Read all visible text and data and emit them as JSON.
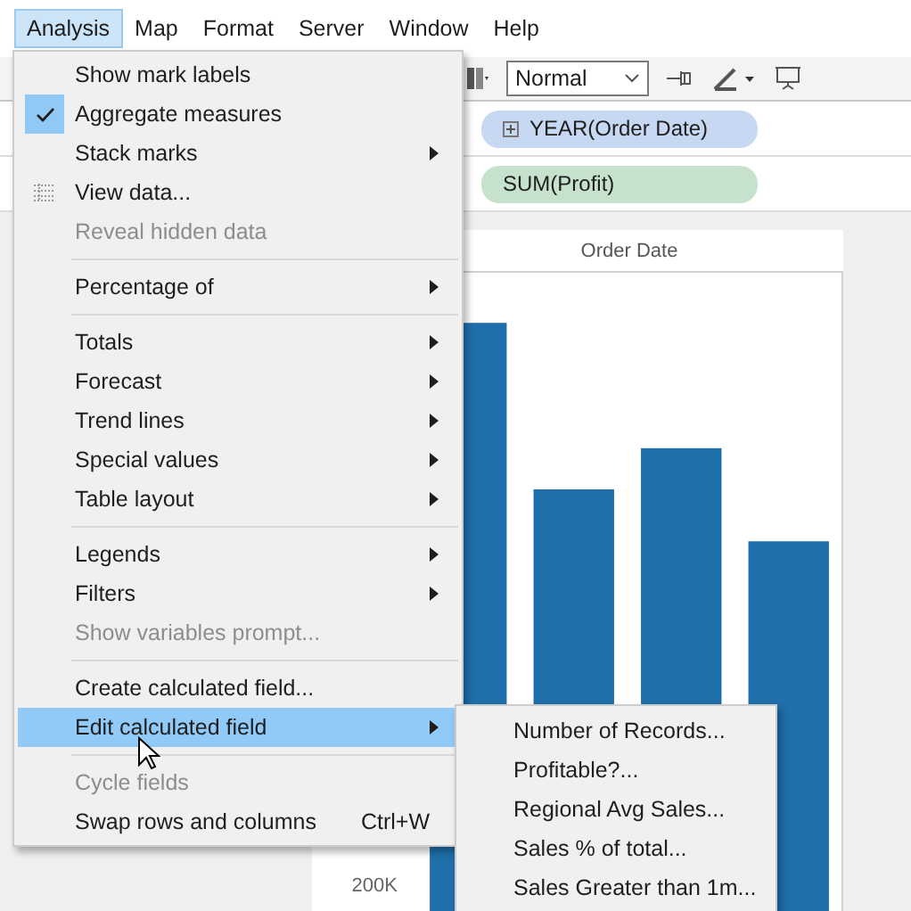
{
  "menubar": [
    {
      "label": "Analysis",
      "selected": true
    },
    {
      "label": "Map",
      "selected": false
    },
    {
      "label": "Format",
      "selected": false
    },
    {
      "label": "Server",
      "selected": false
    },
    {
      "label": "Window",
      "selected": false
    },
    {
      "label": "Help",
      "selected": false
    }
  ],
  "toolbar": {
    "fit_mode": "Normal"
  },
  "columns_shelf": {
    "pill": "YEAR(Order Date)"
  },
  "rows_shelf": {
    "pill": "SUM(Profit)"
  },
  "chart": {
    "header": "Order Date",
    "axis_label": "200K"
  },
  "menu": {
    "items": [
      {
        "kind": "item",
        "label": "Show mark labels",
        "checked": false,
        "disabled": false,
        "submenu": false,
        "selected": false
      },
      {
        "kind": "item",
        "label": "Aggregate measures",
        "checked": true,
        "disabled": false,
        "submenu": false,
        "selected": false
      },
      {
        "kind": "item",
        "label": "Stack marks",
        "checked": false,
        "disabled": false,
        "submenu": true,
        "selected": false
      },
      {
        "kind": "data-item",
        "label": "View data...",
        "checked": false,
        "disabled": false,
        "submenu": false,
        "selected": false
      },
      {
        "kind": "item",
        "label": "Reveal hidden data",
        "checked": false,
        "disabled": true,
        "submenu": false,
        "selected": false
      },
      {
        "kind": "separator"
      },
      {
        "kind": "item",
        "label": "Percentage of",
        "checked": false,
        "disabled": false,
        "submenu": true,
        "selected": false
      },
      {
        "kind": "separator"
      },
      {
        "kind": "item",
        "label": "Totals",
        "checked": false,
        "disabled": false,
        "submenu": true,
        "selected": false
      },
      {
        "kind": "item",
        "label": "Forecast",
        "checked": false,
        "disabled": false,
        "submenu": true,
        "selected": false
      },
      {
        "kind": "item",
        "label": "Trend lines",
        "checked": false,
        "disabled": false,
        "submenu": true,
        "selected": false
      },
      {
        "kind": "item",
        "label": "Special values",
        "checked": false,
        "disabled": false,
        "submenu": true,
        "selected": false
      },
      {
        "kind": "item",
        "label": "Table layout",
        "checked": false,
        "disabled": false,
        "submenu": true,
        "selected": false
      },
      {
        "kind": "separator"
      },
      {
        "kind": "item",
        "label": "Legends",
        "checked": false,
        "disabled": false,
        "submenu": true,
        "selected": false
      },
      {
        "kind": "item",
        "label": "Filters",
        "checked": false,
        "disabled": false,
        "submenu": true,
        "selected": false
      },
      {
        "kind": "item",
        "label": "Show variables prompt...",
        "checked": false,
        "disabled": true,
        "submenu": false,
        "selected": false
      },
      {
        "kind": "separator"
      },
      {
        "kind": "item",
        "label": "Create calculated field...",
        "checked": false,
        "disabled": false,
        "submenu": false,
        "selected": false
      },
      {
        "kind": "item",
        "label": "Edit calculated field",
        "checked": false,
        "disabled": false,
        "submenu": true,
        "selected": true
      },
      {
        "kind": "separator"
      },
      {
        "kind": "item",
        "label": "Cycle fields",
        "checked": false,
        "disabled": true,
        "submenu": false,
        "selected": false
      },
      {
        "kind": "item",
        "label": "Swap rows and columns",
        "checked": false,
        "disabled": false,
        "submenu": false,
        "selected": false,
        "shortcut": "Ctrl+W"
      }
    ]
  },
  "submenu": {
    "items": [
      {
        "label": "Number of Records..."
      },
      {
        "label": "Profitable?..."
      },
      {
        "label": "Regional Avg Sales..."
      },
      {
        "label": "Sales % of total..."
      },
      {
        "label": "Sales Greater than 1m..."
      }
    ]
  }
}
